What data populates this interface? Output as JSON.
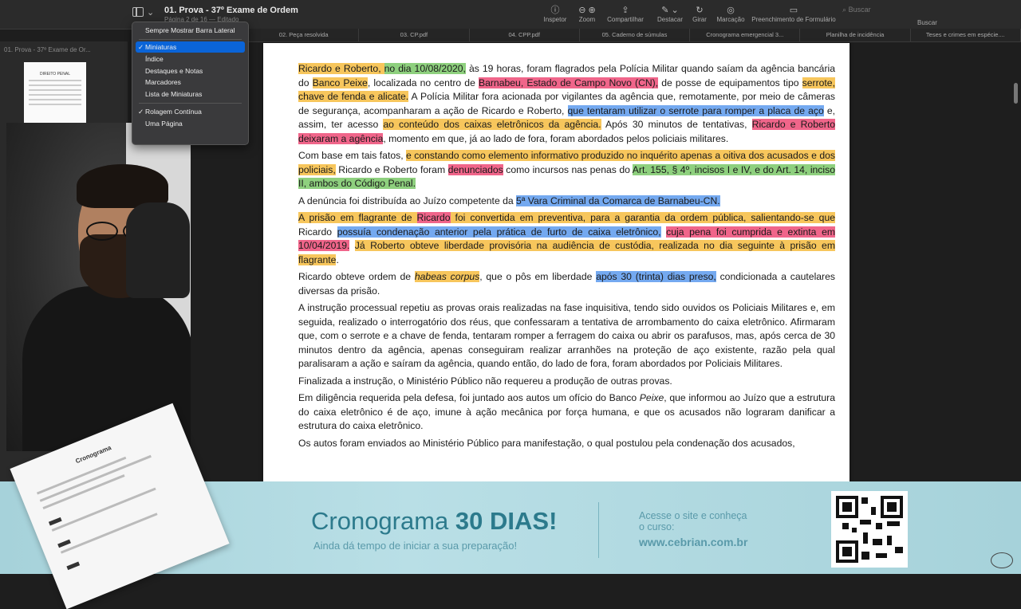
{
  "window": {
    "title": "01. Prova - 37º Exame de Ordem",
    "subtitle": "Página 2 de 16 — Editado"
  },
  "toolbar": {
    "tools": [
      {
        "label": "Inspetor",
        "icon": "info-icon"
      },
      {
        "label": "Zoom",
        "icon": "zoom-icon"
      },
      {
        "label": "Compartilhar",
        "icon": "share-icon"
      },
      {
        "label": "Destacar",
        "icon": "highlight-icon"
      },
      {
        "label": "Girar",
        "icon": "rotate-icon"
      },
      {
        "label": "Marcação",
        "icon": "markup-icon"
      },
      {
        "label": "Preenchimento de Formulário",
        "icon": "form-icon"
      }
    ],
    "search_placeholder": "Buscar",
    "search_label": "Buscar"
  },
  "tabs": [
    "02. Peça resolvida",
    "03. CP.pdf",
    "04. CPP.pdf",
    "05. Caderno de súmulas",
    "Cronograma emergencial 3...",
    "Planilha de incidência",
    "Teses e crimes em espécie...."
  ],
  "sidebar": {
    "title": "01. Prova - 37º Exame de Or...",
    "thumb_heading": "DIREITO PENAL"
  },
  "view_menu": {
    "items": [
      {
        "label": "Sempre Mostrar Barra Lateral",
        "checked": false
      },
      {
        "label": "Miniaturas",
        "checked": true,
        "highlighted": true
      },
      {
        "label": "Índice",
        "checked": false
      },
      {
        "label": "Destaques e Notas",
        "checked": false
      },
      {
        "label": "Marcadores",
        "checked": false
      },
      {
        "label": "Lista de Miniaturas",
        "checked": false
      },
      {
        "label": "Rolagem Contínua",
        "checked": true
      },
      {
        "label": "Uma Página",
        "checked": false
      }
    ]
  },
  "colors": {
    "yellow": "#f7c65c",
    "green": "#8ed07e",
    "pink": "#f0658a",
    "blue": "#74a9f0",
    "banner_text": "#2c7a8c"
  },
  "document": {
    "p1": [
      {
        "t": "Ricardo e Roberto, ",
        "h": "y"
      },
      {
        "t": "no dia 10/08/2020,",
        "h": "g"
      },
      {
        "t": " às 19 horas, foram flagrados pela Polícia Militar quando saíam da agência bancária do "
      },
      {
        "t": "Banco Peixe",
        "h": "y"
      },
      {
        "t": ", localizada no centro de "
      },
      {
        "t": "Barnabeu, Estado de Campo Novo (CN),",
        "h": "p"
      },
      {
        "t": " de posse de equipamentos tipo "
      },
      {
        "t": "serrote, chave de fenda e alicate.",
        "h": "y"
      },
      {
        "t": " A Polícia Militar fora acionada por vigilantes da agência que, remotamente, por meio de câmeras de segurança, acompanharam a ação de Ricardo e Roberto, "
      },
      {
        "t": "que tentaram utilizar o serrote para romper a placa de aço",
        "h": "b"
      },
      {
        "t": " e, assim, ter acesso "
      },
      {
        "t": "ao conteúdo dos caixas eletrônicos da agência.",
        "h": "y"
      },
      {
        "t": " Após 30 minutos de tentativas, "
      },
      {
        "t": "Ricardo e Roberto deixaram a agência",
        "h": "p"
      },
      {
        "t": ", momento em que, já ao lado de fora, foram abordados pelos policiais militares."
      }
    ],
    "p2": [
      {
        "t": "Com base em tais fatos, "
      },
      {
        "t": "e constando como elemento informativo produzido no inquérito apenas a oitiva dos acusados e dos policiais,",
        "h": "y"
      },
      {
        "t": " Ricardo e Roberto foram "
      },
      {
        "t": "denunciados",
        "h": "p"
      },
      {
        "t": " como incursos nas penas do "
      },
      {
        "t": "Art. 155, § 4º, incisos I e IV, e do Art. 14, inciso II, ambos do Código Penal.",
        "h": "g"
      }
    ],
    "p3": [
      {
        "t": "A denúncia foi distribuída ao Juízo competente da "
      },
      {
        "t": "5ª Vara Criminal da Comarca de Barnabeu-CN.",
        "h": "b"
      }
    ],
    "p4": [
      {
        "t": "A prisão em flagrante de ",
        "h": "y"
      },
      {
        "t": "Ricardo",
        "h": "p"
      },
      {
        "t": " foi convertida em preventiva, para a garantia da ordem pública, salientando-se que",
        "h": "y"
      },
      {
        "t": " Ricardo "
      },
      {
        "t": "possuía condenação anterior pela prática de furto de caixa eletrônico,",
        "h": "b"
      },
      {
        "t": " "
      },
      {
        "t": "cuja pena foi cumprida e extinta em 10/04/2019.",
        "h": "p"
      },
      {
        "t": " "
      },
      {
        "t": "Já Roberto obteve liberdade provisória na audiência de custódia, realizada no dia seguinte à prisão em flagrante",
        "h": "y"
      },
      {
        "t": "."
      }
    ],
    "p5": [
      {
        "t": "Ricardo obteve ordem de "
      },
      {
        "t": "habeas corpus",
        "h": "y",
        "i": true
      },
      {
        "t": ", que o pôs em liberdade "
      },
      {
        "t": "após 30 (trinta) dias preso,",
        "h": "b"
      },
      {
        "t": " condicionada a cautelares diversas da prisão."
      }
    ],
    "p6": [
      {
        "t": "A instrução processual repetiu as provas orais realizadas na fase inquisitiva, tendo sido ouvidos os Policiais Militares e, em seguida, realizado o interrogatório dos réus, que confessaram a tentativa de arrombamento do caixa eletrônico. Afirmaram que, com o serrote e a chave de fenda, tentaram romper a ferragem do caixa ou abrir os parafusos, mas, após cerca de 30 minutos dentro da agência, apenas conseguiram realizar arranhões na proteção de aço existente, razão pela qual paralisaram a ação e saíram da agência, quando então, do lado de fora, foram abordados por Policiais Militares."
      }
    ],
    "p7": [
      {
        "t": "Finalizada a instrução, o Ministério Público não requereu a produção de outras provas."
      }
    ],
    "p8": [
      {
        "t": "Em diligência requerida pela defesa, foi juntado aos autos um ofício do Banco "
      },
      {
        "t": "Peixe",
        "i": true
      },
      {
        "t": ", que informou ao Juízo que a estrutura do caixa eletrônico é de aço, imune à ação mecânica por força humana, e que os acusados não lograram danificar a estrutura do caixa eletrônico."
      }
    ],
    "p9": [
      {
        "t": "Os autos foram enviados ao Ministério Público para manifestação, o qual postulou pela condenação dos acusados,"
      }
    ]
  },
  "banner": {
    "title_plain": "Cronograma ",
    "title_bold": "30 DIAS!",
    "subtitle": "Ainda dá tempo de iniciar a sua preparação!",
    "access_text": "Acesse o site e conheça o curso:",
    "url": "www.cebrian.com.br",
    "paper_title": "Cronograma"
  }
}
